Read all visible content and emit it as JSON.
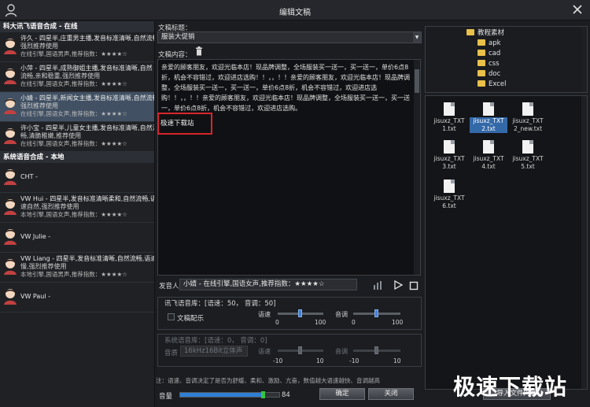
{
  "window": {
    "title": "编辑文稿"
  },
  "left_panel": {
    "group_online": "科大讯飞语音合成 - 在线",
    "online_voices": [
      {
        "line1": "许久 - 四星半,庄重男主播,发音标准清晰,自然流畅,",
        "line2": "强烈推荐使用",
        "line3": "在线引擎,国语男声,推荐指数：★★★★☆"
      },
      {
        "line1": "小萍 - 四星半,成熟御姐主播,发音标准清晰,自然",
        "line2": "流畅,亲和稳重,强烈推荐使用",
        "line3": "在线引擎,国语女声,推荐指数：★★★★☆"
      },
      {
        "line1": "小婧 - 四星半,新闻女主播,发音标准清晰,自然流畅",
        "line2": "强烈推荐使用",
        "line3": "在线引擎,国语女声,推荐指数：★★★★☆"
      },
      {
        "line1": "许小宝 - 四星半,儿童女主播,发音标准清晰,自然流",
        "line2": "畅,清脆稚嫩,推荐使用",
        "line3": "在线引擎,国语女声,推荐指数：★★★★☆"
      }
    ],
    "group_system": "系统语音合成 - 本地",
    "system_voices": [
      {
        "line1": "CHT -",
        "line2": "",
        "line3": ""
      },
      {
        "line1": "VW Hui - 四星半,发音标准清晰柔和,自然流畅,语",
        "line2": "速自然,强烈推荐使用",
        "line3": "本地引擎,国语女声,推荐指数：★★★★☆"
      },
      {
        "line1": "VW Julie -",
        "line2": "",
        "line3": ""
      },
      {
        "line1": "VW Liang - 四星半,发音标准清晰,自然流畅,语速稍",
        "line2": "慢,强烈推荐使用",
        "line3": "本地引擎,国语男声,推荐指数：★★★★☆"
      },
      {
        "line1": "VW Paul -",
        "line2": "",
        "line3": ""
      }
    ]
  },
  "editor": {
    "title_label": "文稿标题：",
    "title_value": "服装大促销",
    "content_label": "文稿内容：",
    "content_text": "亲爱的顾客朋友，欢迎光临本店！现品牌调整，全场服装买一送一，买一送一，单价6点8折，机会不容错过，欢迎进店选购！！，，！！亲爱的顾客朋友，欢迎光临本店！现品牌调整，全场服装买一送一，买一送一，单价6点8折，机会不容错过，欢迎进店选购！！，，！！亲爱的顾客朋友，欢迎光临本店！现品牌调整，全场服装买一送一，买一送一，单价6点8折，机会不容错过，欢迎进店选购。",
    "highlight_text": "极速下载站",
    "speaker_label": "发音人",
    "speaker_value": "小婧 - 在线引擎,国语女声,推荐指数：★★★★☆"
  },
  "online_settings": {
    "header": "讯飞语音库：[语速：50， 音调：50]",
    "bg_music_label": "文稿配乐",
    "speed_label": "语速",
    "pitch_label": "音调",
    "speed_min": "0",
    "speed_max": "100",
    "speed_value": 50,
    "pitch_min": "0",
    "pitch_max": "100",
    "pitch_value": 50
  },
  "system_settings": {
    "header": "系统语音库：[语速：0， 音调：0]",
    "quality_label": "音质",
    "quality_value": "16kHz16Bit立体声",
    "speed_label": "语速",
    "pitch_label": "音调",
    "speed_min": "-10",
    "speed_max": "10",
    "speed_value": 0,
    "pitch_min": "-10",
    "pitch_max": "10",
    "pitch_value": 0
  },
  "footnote": "注：语速、音调决定了是否为舒缓、柔和、激励、亢奋，数值越大语速越快、音调越高",
  "volume": {
    "label": "音量",
    "value": 84,
    "display": "84"
  },
  "buttons": {
    "ok": "确定",
    "close": "关闭",
    "export": "导入文件内容"
  },
  "tree": {
    "items": [
      "教程素材",
      "apk",
      "cad",
      "css",
      "doc",
      "Excel"
    ]
  },
  "files": [
    "jisuxz_TXT1.txt",
    "jisuxz_TXT2.txt",
    "jisuxz_TXT2_new.txt",
    "jisuxz_TXT3.txt",
    "jisuxz_TXT4.txt",
    "jisuxz_TXT5.txt",
    "jisuxz_TXT6.txt"
  ],
  "file_labels": [
    [
      "jisuxz_TXT",
      "1.txt"
    ],
    [
      "jisuxz_TXT",
      "2.txt"
    ],
    [
      "jisuxz_TXT",
      "2_new.txt"
    ],
    [
      "jisuxz_TXT",
      "3.txt"
    ],
    [
      "jisuxz_TXT",
      "4.txt"
    ],
    [
      "jisuxz_TXT",
      "5.txt"
    ],
    [
      "jisuxz_TXT",
      "6.txt"
    ]
  ],
  "watermark": "极速下载站",
  "colors": {
    "accent": "#3f7fd6",
    "highlight_border": "#d8262c",
    "selected_row": "#415063",
    "folder": "#e9c04a"
  }
}
